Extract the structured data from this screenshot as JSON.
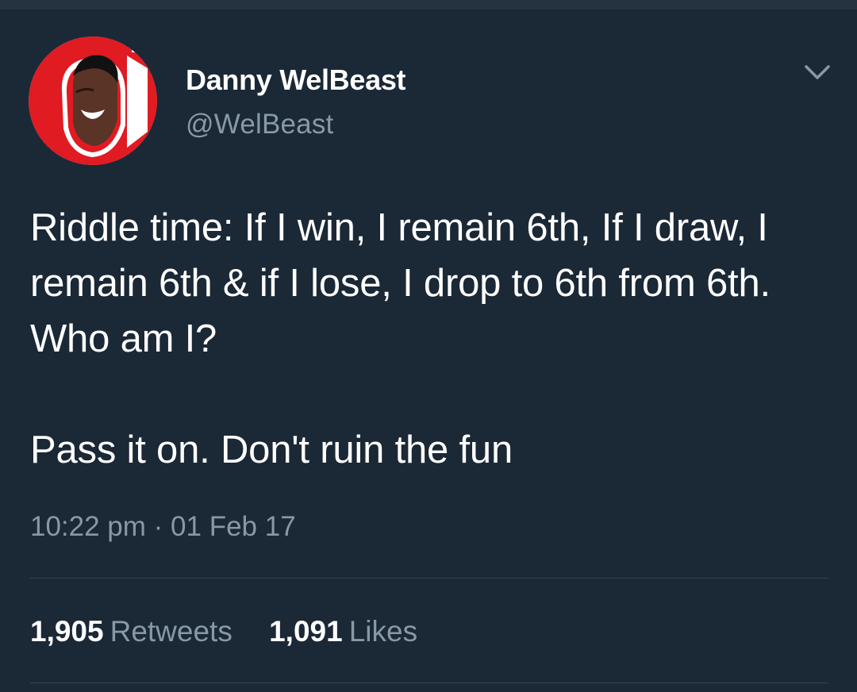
{
  "tweet": {
    "author": {
      "display_name": "Danny WelBeast",
      "handle": "@WelBeast",
      "avatar_icon": "avatar-illustration"
    },
    "menu_icon": "chevron-down-icon",
    "text_paragraphs": [
      "Riddle time: If I win, I remain 6th, If I draw, I remain 6th & if I lose, I drop to 6th from 6th. Who am I?",
      "Pass it on. Don't ruin the fun"
    ],
    "timestamp": "10:22 pm · 01 Feb 17",
    "stats": {
      "retweets_count": "1,905",
      "retweets_label": "Retweets",
      "likes_count": "1,091",
      "likes_label": "Likes"
    }
  },
  "colors": {
    "background": "#1b2836",
    "text_primary": "#ffffff",
    "text_secondary": "#8899a6",
    "divider": "#38444d",
    "avatar_red": "#e01b22"
  }
}
